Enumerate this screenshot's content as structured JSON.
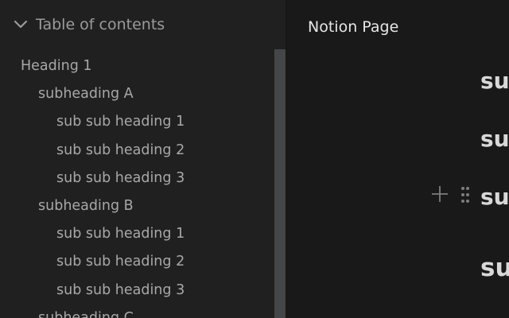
{
  "toc": {
    "title": "Table of contents",
    "items": [
      {
        "label": "Heading 1"
      },
      {
        "label": "subheading A"
      },
      {
        "label": "sub sub heading 1"
      },
      {
        "label": "sub sub heading 2"
      },
      {
        "label": "sub sub heading 3"
      },
      {
        "label": "subheading B"
      },
      {
        "label": "sub sub heading 1"
      },
      {
        "label": "sub sub heading 2"
      },
      {
        "label": "sub sub heading 3"
      },
      {
        "label": "subheading C"
      }
    ]
  },
  "page": {
    "title": "Notion Page",
    "visible_heading_fragments": [
      "sub",
      "sub",
      "sub",
      "sub"
    ]
  },
  "icons": {
    "toc_toggle": "chevron-down-icon",
    "add_block": "plus-icon",
    "drag_handle": "drag-handle-icon"
  },
  "colors": {
    "sidebar_bg": "#202020",
    "page_bg": "#191919",
    "scrollbar_thumb": "#444648",
    "toc_text": "#a8a8a8",
    "heading_text": "#d8d8d8"
  }
}
